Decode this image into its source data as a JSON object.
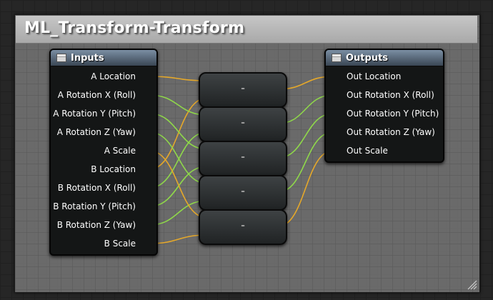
{
  "comment": {
    "title": "ML_Transform-Transform"
  },
  "inputs_node": {
    "title": "Inputs",
    "pins": [
      {
        "label": "A Location",
        "type": "vector"
      },
      {
        "label": "A Rotation X (Roll)",
        "type": "float"
      },
      {
        "label": "A Rotation Y (Pitch)",
        "type": "float"
      },
      {
        "label": "A Rotation Z (Yaw)",
        "type": "float"
      },
      {
        "label": "A Scale",
        "type": "vector"
      },
      {
        "label": "B Location",
        "type": "vector"
      },
      {
        "label": "B Rotation X (Roll)",
        "type": "float"
      },
      {
        "label": "B Rotation Y (Pitch)",
        "type": "float"
      },
      {
        "label": "B Rotation Z (Yaw)",
        "type": "float"
      },
      {
        "label": "B Scale",
        "type": "vector"
      }
    ]
  },
  "outputs_node": {
    "title": "Outputs",
    "pins": [
      {
        "label": "Out Location",
        "type": "vector"
      },
      {
        "label": "Out Rotation X (Roll)",
        "type": "float"
      },
      {
        "label": "Out Rotation Y (Pitch)",
        "type": "float"
      },
      {
        "label": "Out Rotation Z (Yaw)",
        "type": "float"
      },
      {
        "label": "Out Scale",
        "type": "vector"
      }
    ]
  },
  "operator_nodes": [
    {
      "symbol": "-",
      "type": "vector"
    },
    {
      "symbol": "-",
      "type": "float"
    },
    {
      "symbol": "-",
      "type": "float"
    },
    {
      "symbol": "-",
      "type": "float"
    },
    {
      "symbol": "-",
      "type": "vector"
    }
  ],
  "colors": {
    "vector_pin": "#f5b522",
    "float_pin": "#9ef03f",
    "vector_wire": "#e5a82a",
    "float_wire": "#8fd84a"
  }
}
